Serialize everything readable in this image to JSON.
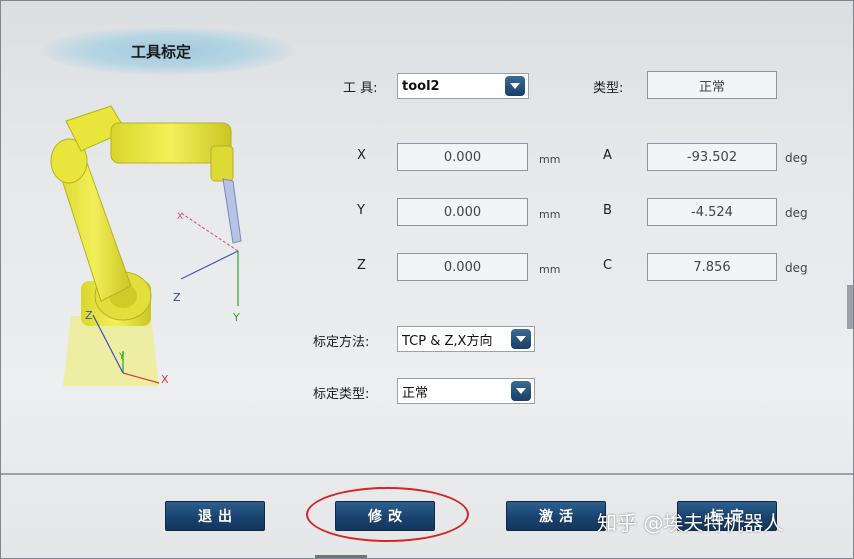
{
  "title": "工具标定",
  "tool": {
    "label": "工 具:",
    "value": "tool2"
  },
  "type": {
    "label": "类型:",
    "value": "正常"
  },
  "coords": [
    {
      "axis": "X",
      "value": "0.000",
      "unit": "mm"
    },
    {
      "axis": "Y",
      "value": "0.000",
      "unit": "mm"
    },
    {
      "axis": "Z",
      "value": "0.000",
      "unit": "mm"
    }
  ],
  "angles": [
    {
      "axis": "A",
      "value": "-93.502",
      "unit": "deg"
    },
    {
      "axis": "B",
      "value": "-4.524",
      "unit": "deg"
    },
    {
      "axis": "C",
      "value": "7.856",
      "unit": "deg"
    }
  ],
  "method": {
    "label": "标定方法:",
    "value": "TCP & Z,X方向"
  },
  "calib_type": {
    "label": "标定类型:",
    "value": "正常"
  },
  "robot_axes": {
    "x": "X",
    "y": "Y",
    "z": "Z"
  },
  "buttons": {
    "exit": "退出",
    "modify": "修改",
    "activate": "激活",
    "fourth": "标定"
  },
  "watermark": "知乎 @埃夫特机器人",
  "colors": {
    "button": "#1a4270",
    "highlight": "#d62525",
    "robot": "#e8e63a"
  }
}
